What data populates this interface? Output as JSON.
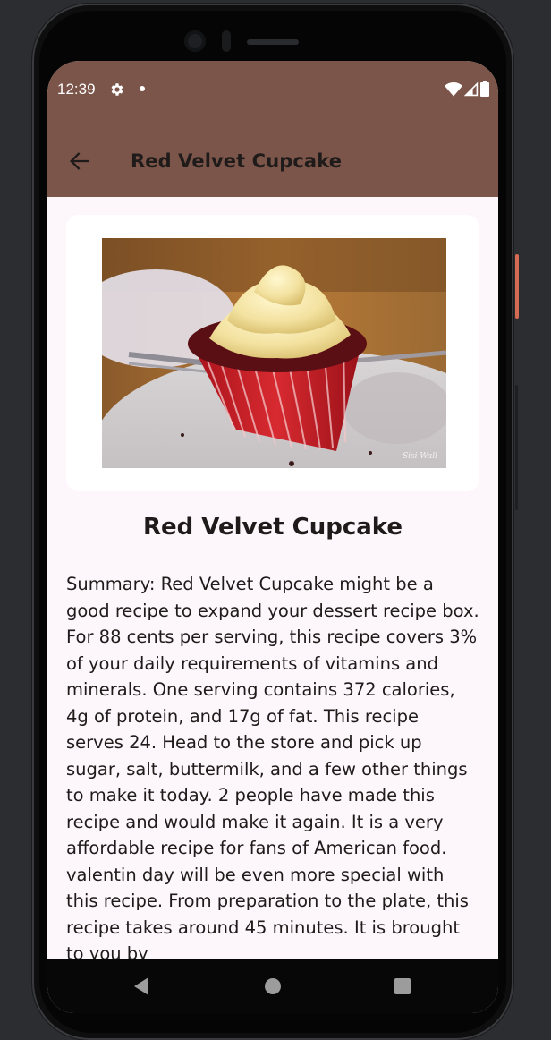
{
  "status_bar": {
    "time": "12:39",
    "icons": [
      "gear-icon",
      "notification-dot",
      "wifi-icon",
      "signal-icon",
      "battery-icon"
    ]
  },
  "app_bar": {
    "back_icon": "arrow-left-icon",
    "title": "Red Velvet Cupcake"
  },
  "recipe": {
    "image_alt": "red velvet cupcake photo",
    "image_watermark": "Sisi Wall",
    "title": "Red Velvet Cupcake",
    "summary": "Summary: Red Velvet Cupcake might be a good recipe to expand your dessert recipe box. For 88 cents per serving, this recipe covers 3% of your daily requirements of vitamins and minerals. One serving contains 372 calories, 4g of protein, and 17g of fat. This recipe serves 24. Head to the store and pick up sugar, salt, buttermilk, and a few other things to make it today. 2 people have made this recipe and would make it again. It is a very affordable recipe for fans of American food. valentin day will be even more special with this recipe. From preparation to the plate, this recipe takes around 45 minutes. It is brought to you by"
  },
  "nav_bar": {
    "back": "nav-back-icon",
    "home": "nav-home-icon",
    "recents": "nav-recents-icon"
  },
  "colors": {
    "app_bar": "#7b5549",
    "background": "#fdf6fb",
    "text": "#1f1b1a",
    "card": "#ffffff"
  }
}
